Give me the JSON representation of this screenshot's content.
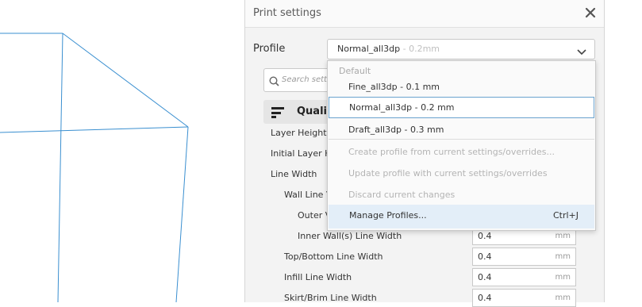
{
  "panel": {
    "title": "Print settings",
    "close_icon": "close-icon",
    "profile_label": "Profile",
    "profile_value": "Normal_all3dp",
    "profile_value_sub": " - 0.2mm",
    "search_placeholder": "Search setti",
    "category_label": "Qualit",
    "category_icon": "quality-lines-icon"
  },
  "settings": [
    {
      "label": "Layer Height"
    },
    {
      "label": "Initial Layer H"
    },
    {
      "label": "Line Width"
    },
    {
      "label": "Wall Line V"
    },
    {
      "label": "Outer V"
    },
    {
      "label": "Inner Wall(s) Line Width",
      "value": "0.4",
      "unit": "mm"
    },
    {
      "label": "Top/Bottom Line Width",
      "value": "0.4",
      "unit": "mm"
    },
    {
      "label": "Infill Line Width",
      "value": "0.4",
      "unit": "mm"
    },
    {
      "label": "Skirt/Brim Line Width",
      "value": "0.4",
      "unit": "mm"
    }
  ],
  "dropdown": {
    "section_label": "Default",
    "items": [
      {
        "label": "Fine_all3dp - 0.1 mm"
      },
      {
        "label": "Normal_all3dp - 0.2 mm"
      },
      {
        "label": "Draft_all3dp - 0.3 mm"
      }
    ],
    "actions": [
      {
        "label": "Create profile from current settings/overrides..."
      },
      {
        "label": "Update profile with current settings/overrides"
      },
      {
        "label": "Discard current changes"
      }
    ],
    "manage_label": "Manage Profiles...",
    "manage_shortcut": "Ctrl+J"
  },
  "colors": {
    "wireframe": "#3a8fd0",
    "selected_border": "#6aa3cf",
    "hover_bg": "#e3eef8"
  }
}
